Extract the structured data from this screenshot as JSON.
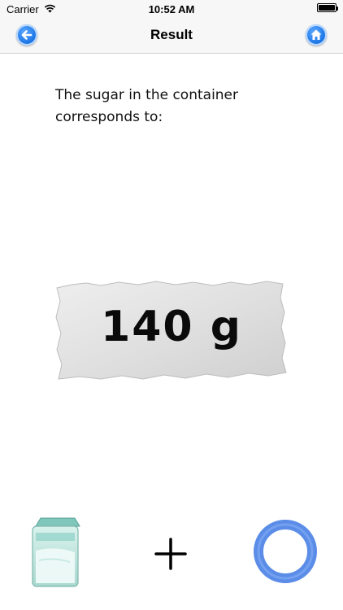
{
  "status_bar": {
    "carrier": "Carrier",
    "time": "10:52 AM",
    "battery_level": 1.0,
    "icons": [
      "wifi-icon",
      "battery-icon"
    ]
  },
  "nav": {
    "title": "Result",
    "back_icon": "arrow-left-icon",
    "home_icon": "home-icon",
    "accent_color": "#1e78e6"
  },
  "result": {
    "message": "The sugar in the container corresponds to:",
    "amount": "140 g"
  },
  "toolbar": {
    "icons": [
      "sugar-bag-icon",
      "plus-icon",
      "ring-icon"
    ],
    "ring_color": "#5b8de8"
  }
}
